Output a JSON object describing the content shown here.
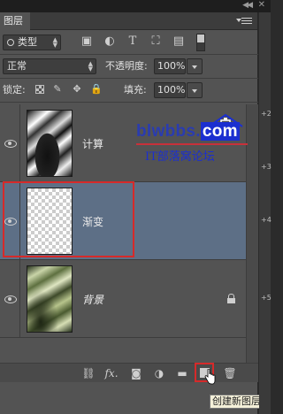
{
  "panel": {
    "tab_label": "图层",
    "window_arrows": "◀◀",
    "window_close": "✕"
  },
  "filter": {
    "kind_label": "类型",
    "icons": [
      "image-filter-icon",
      "adjustment-filter-icon",
      "type-filter-icon",
      "shape-filter-icon",
      "smartobject-filter-icon"
    ]
  },
  "blend": {
    "mode": "正常",
    "opacity_label": "不透明度:",
    "opacity_value": "100%"
  },
  "locks": {
    "label": "锁定:",
    "fill_label": "填充:",
    "fill_value": "100%"
  },
  "layers": [
    {
      "name": "计算",
      "thumb": "bw",
      "selected": false
    },
    {
      "name": "渐变",
      "thumb": "transparent",
      "selected": true
    },
    {
      "name": "背景",
      "thumb": "green",
      "selected": false,
      "locked": true
    }
  ],
  "bottom": {
    "fx_label": "fx.",
    "tooltip": "创建新图层"
  },
  "watermark": {
    "brand": "blwbbs.",
    "tld": "com",
    "subtitle": "IT部落窝论坛"
  },
  "right_edge_labels": [
    "+2",
    "+3",
    "+4",
    "+5"
  ],
  "colors": {
    "panel_bg": "#535353",
    "selected_layer": "#5d6f86",
    "highlight_red": "#d62a2a",
    "watermark_blue": "#1b2fd0"
  }
}
